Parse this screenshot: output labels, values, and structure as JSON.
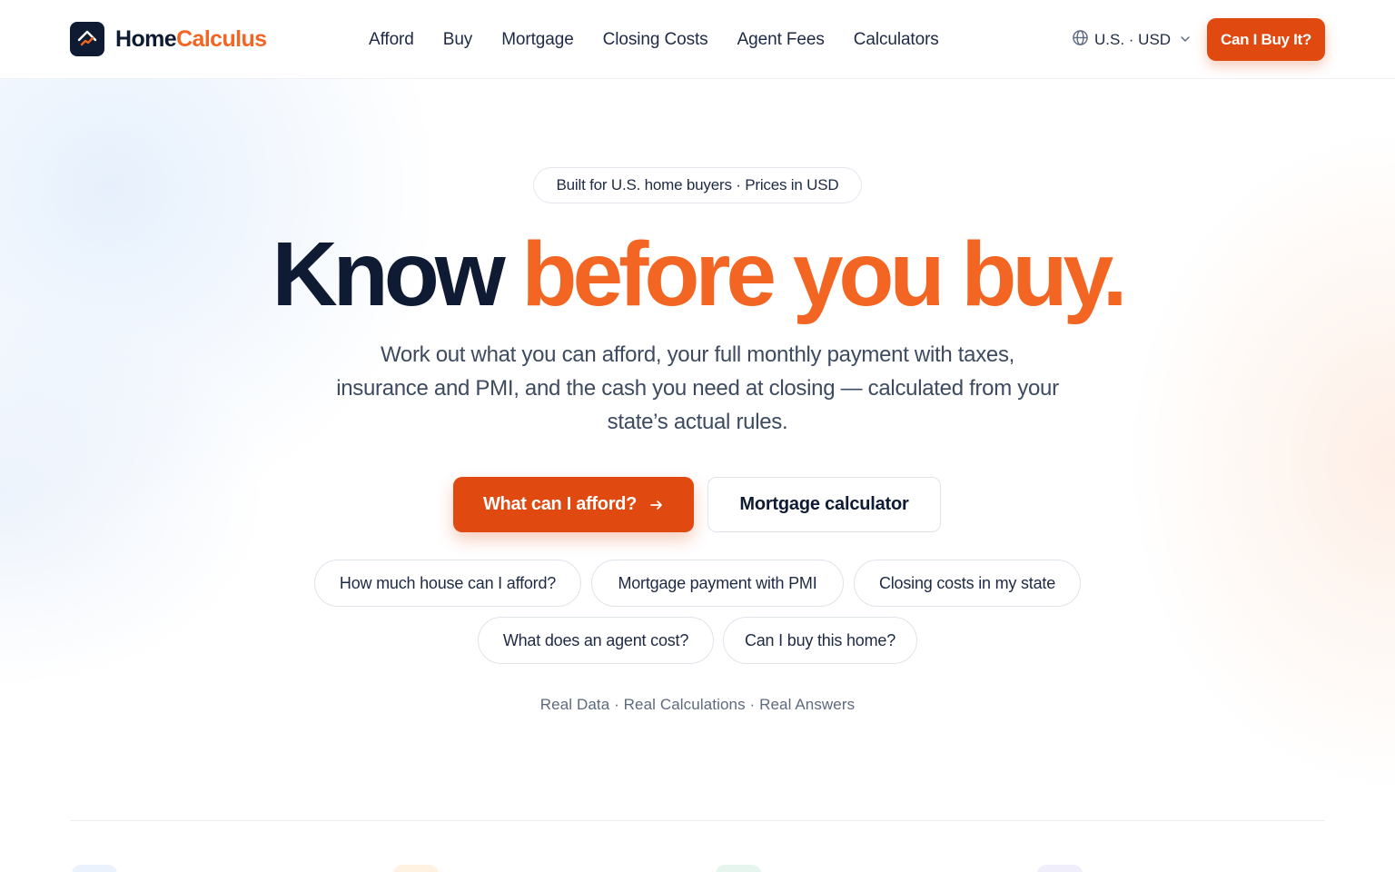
{
  "brand": {
    "name_part1": "Home",
    "name_part2": "Calculus",
    "colors": {
      "navy": "#0f1b33",
      "orange": "#f26522",
      "cta": "#e0490f"
    }
  },
  "nav": {
    "items": [
      {
        "label": "Afford"
      },
      {
        "label": "Buy"
      },
      {
        "label": "Mortgage"
      },
      {
        "label": "Closing Costs"
      },
      {
        "label": "Agent Fees"
      },
      {
        "label": "Calculators"
      }
    ]
  },
  "locale": {
    "label": "U.S. · USD",
    "icon": "globe-icon"
  },
  "header_cta": {
    "label": "Can I Buy It?"
  },
  "hero": {
    "tag": "Built for U.S. home buyers · Prices in USD",
    "headline_part1": "Know",
    "headline_part2": "before you buy.",
    "subtitle": "Work out what you can afford, your full monthly payment with taxes, insurance and PMI, and the cash you need at closing — calculated from your state’s actual rules.",
    "primary_button": "What can I afford?",
    "secondary_button": "Mortgage calculator",
    "chips": [
      "How much house can I afford?",
      "Mortgage payment with PMI",
      "Closing costs in my state",
      "What does an agent cost?",
      "Can I buy this home?"
    ],
    "tagline": "Real Data · Real Calculations · Real Answers"
  }
}
